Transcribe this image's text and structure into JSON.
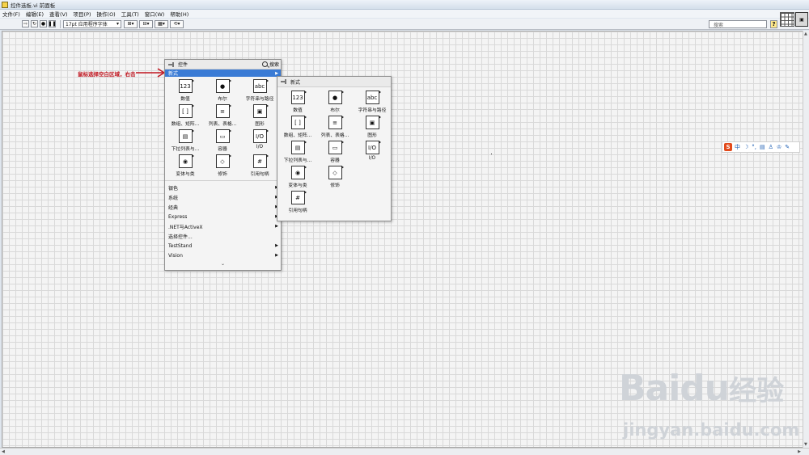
{
  "window": {
    "title": "控件选板.vi 前面板"
  },
  "menu": [
    "文件(F)",
    "编辑(E)",
    "查看(V)",
    "项目(P)",
    "操作(O)",
    "工具(T)",
    "窗口(W)",
    "帮助(H)"
  ],
  "toolbar": {
    "font": "17pt 应用程序字体",
    "search_placeholder": "搜索",
    "help": "?"
  },
  "annotation": "鼠标选择空白区域，右击",
  "controls_palette": {
    "title": "控件",
    "search_label": "搜索",
    "selected_category": "新式",
    "items": [
      {
        "label": "数值",
        "glyph": "123"
      },
      {
        "label": "布尔",
        "glyph": "●"
      },
      {
        "label": "字符串与路径",
        "glyph": "abc"
      },
      {
        "label": "数组、矩阵...",
        "glyph": "[ ]"
      },
      {
        "label": "列表、表格...",
        "glyph": "≡"
      },
      {
        "label": "图形",
        "glyph": "▣"
      },
      {
        "label": "下拉列表与...",
        "glyph": "▤"
      },
      {
        "label": "容器",
        "glyph": "▭"
      },
      {
        "label": "I/O",
        "glyph": "I/O"
      },
      {
        "label": "变体与类",
        "glyph": "◉"
      },
      {
        "label": "修饰",
        "glyph": "◇"
      },
      {
        "label": "引用句柄",
        "glyph": "#"
      }
    ],
    "categories": [
      {
        "label": "银色",
        "submenu": true
      },
      {
        "label": "系统",
        "submenu": true
      },
      {
        "label": "经典",
        "submenu": true
      },
      {
        "label": "Express",
        "submenu": true
      },
      {
        "label": ".NET与ActiveX",
        "submenu": true
      },
      {
        "label": "选择控件...",
        "submenu": false
      },
      {
        "label": "TestStand",
        "submenu": true
      },
      {
        "label": "Vision",
        "submenu": true
      }
    ],
    "more": "⌄"
  },
  "modern_palette": {
    "title": "新式",
    "items": [
      {
        "label": "数值",
        "glyph": "123"
      },
      {
        "label": "布尔",
        "glyph": "●"
      },
      {
        "label": "字符串与路径",
        "glyph": "abc"
      },
      {
        "label": "数组、矩阵...",
        "glyph": "[ ]"
      },
      {
        "label": "列表、表格...",
        "glyph": "≡"
      },
      {
        "label": "图形",
        "glyph": "▣"
      },
      {
        "label": "下拉列表与...",
        "glyph": "▤"
      },
      {
        "label": "容器",
        "glyph": "▭"
      },
      {
        "label": "I/O",
        "glyph": "I/O"
      },
      {
        "label": "变体与类",
        "glyph": "◉"
      },
      {
        "label": "修饰",
        "glyph": "◇"
      },
      {
        "label": "引用句柄",
        "glyph": "#"
      }
    ]
  },
  "ime": {
    "logo": "S",
    "mode": "中"
  },
  "watermark": {
    "logo": "Baidu",
    "cn": "经验",
    "url": "jingyan.baidu.com"
  }
}
